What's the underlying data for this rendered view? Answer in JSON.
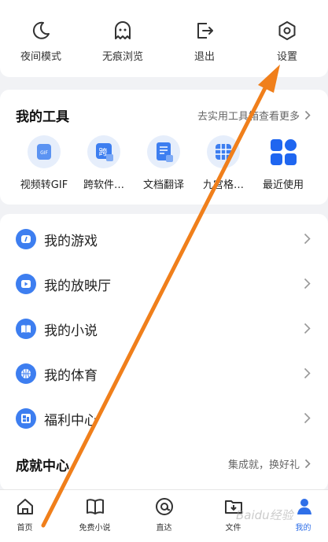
{
  "top_bar": {
    "items": [
      {
        "label": "夜间模式",
        "icon": "moon-icon"
      },
      {
        "label": "无痕浏览",
        "icon": "ghost-icon"
      },
      {
        "label": "退出",
        "icon": "exit-icon"
      },
      {
        "label": "设置",
        "icon": "settings-icon"
      }
    ]
  },
  "tools": {
    "title": "我的工具",
    "more": "去实用工具箱查看更多",
    "items": [
      {
        "label": "视频转GIF",
        "icon": "gif-icon"
      },
      {
        "label": "跨软件…",
        "icon": "translate-icon"
      },
      {
        "label": "文档翻译",
        "icon": "doc-translate-icon"
      },
      {
        "label": "九宫格…",
        "icon": "grid-icon"
      },
      {
        "label": "最近使用",
        "icon": "apps-icon"
      }
    ]
  },
  "menu": {
    "items": [
      {
        "label": "我的游戏",
        "icon": "game-icon"
      },
      {
        "label": "我的放映厅",
        "icon": "play-icon"
      },
      {
        "label": "我的小说",
        "icon": "book-icon"
      },
      {
        "label": "我的体育",
        "icon": "basketball-icon"
      },
      {
        "label": "福利中心",
        "icon": "gift-icon"
      }
    ]
  },
  "achievement": {
    "title": "成就中心",
    "more": "集成就，换好礼"
  },
  "bottom_nav": {
    "items": [
      {
        "label": "首页",
        "icon": "home-icon"
      },
      {
        "label": "免费小说",
        "icon": "book-icon"
      },
      {
        "label": "直达",
        "icon": "at-icon"
      },
      {
        "label": "文件",
        "icon": "folder-icon"
      },
      {
        "label": "我的",
        "icon": "profile-icon",
        "active": true
      }
    ]
  },
  "watermark": "Baidu经验",
  "colors": {
    "accent": "#3d7ef0",
    "arrow": "#f07f1b",
    "background": "#f1f2f5"
  }
}
